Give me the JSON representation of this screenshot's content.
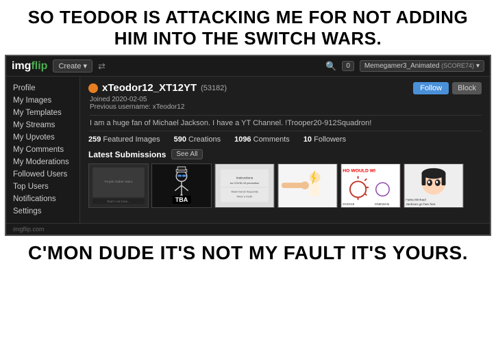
{
  "meme": {
    "top_text": "SO TEODOR IS ATTACKING ME FOR NOT ADDING HIM INTO THE SWITCH WARS.",
    "bottom_text": "C'MON DUDE IT'S NOT MY FAULT IT'S YOURS."
  },
  "navbar": {
    "logo": "imgflip",
    "create_label": "Create",
    "search_icon": "search",
    "notif_count": "0",
    "username": "Memegamer3_Animated",
    "username_score": "(SCORE74)"
  },
  "sidebar": {
    "items": [
      {
        "label": "Profile"
      },
      {
        "label": "My Images"
      },
      {
        "label": "My Templates"
      },
      {
        "label": "My Streams"
      },
      {
        "label": "My Upvotes"
      },
      {
        "label": "My Comments"
      },
      {
        "label": "My Moderations"
      },
      {
        "label": "Followed Users"
      },
      {
        "label": "Top Users"
      },
      {
        "label": "Notifications"
      },
      {
        "label": "Settings"
      }
    ]
  },
  "profile": {
    "username": "xTeodor12_XT12YT",
    "score": "(53182)",
    "joined": "Joined 2020-02-05",
    "prev_username": "Previous username: xTeodor12",
    "bio": "I am a huge fan of Michael Jackson. I have a YT Channel. !Trooper20-912Squadron!",
    "follow_label": "Follow",
    "block_label": "Block",
    "stats": [
      {
        "value": "259",
        "label": "Featured Images"
      },
      {
        "value": "590",
        "label": "Creations"
      },
      {
        "value": "1096",
        "label": "Comments"
      },
      {
        "value": "10",
        "label": "Followers"
      }
    ],
    "latest_heading": "Latest Submissions",
    "see_all_label": "See All"
  },
  "footer": {
    "text": "imgflip.com"
  }
}
